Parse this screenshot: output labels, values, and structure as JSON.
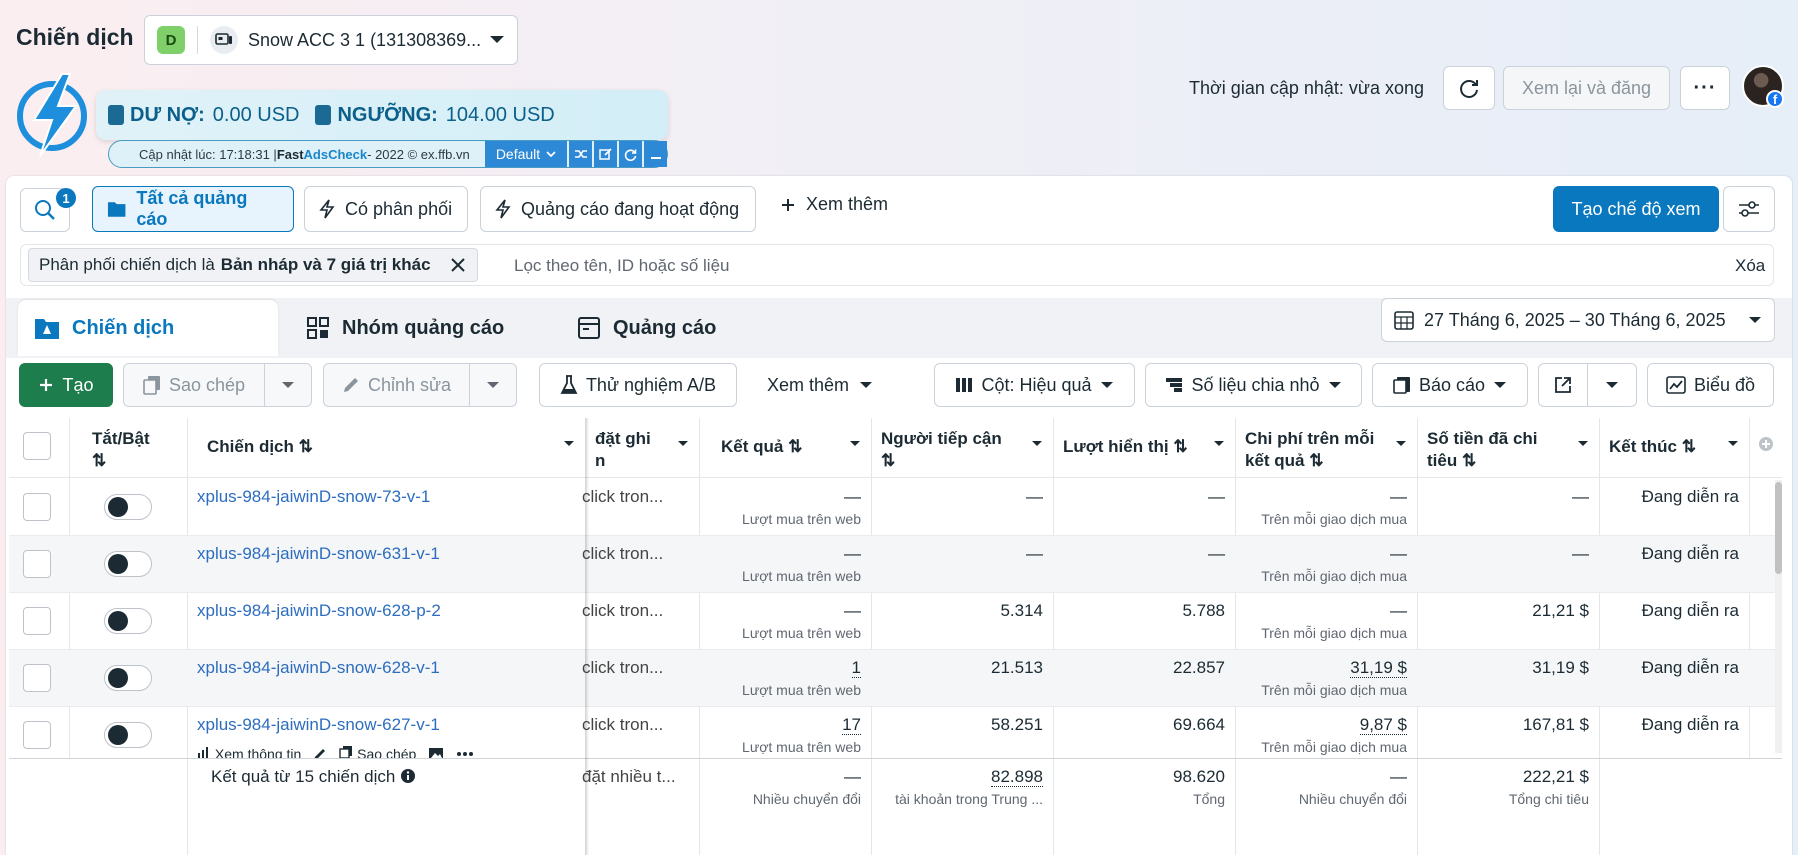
{
  "header": {
    "title": "Chiến dịch",
    "account": {
      "badge": "D",
      "name": "Snow ACC 3 1 (131308369..."
    },
    "update_time": "Thời gian cập nhật: vừa xong",
    "review_label": "Xem lại và đăng",
    "more_label": "···",
    "fb_badge": "f"
  },
  "adscheck": {
    "debt_label": "DƯ NỢ:",
    "debt_value": "0.00 USD",
    "threshold_label": "NGƯỠNG:",
    "threshold_value": "104.00 USD",
    "status_prefix": "Cập nhật lúc: 17:18:31 | ",
    "brand_fast": "Fast ",
    "brand_ads": "AdsCheck",
    "status_suffix": " - 2022 © ex.ffb.vn",
    "default_label": "Default"
  },
  "views": {
    "search_count": "1",
    "all_ads": "Tất cả quảng cáo",
    "has_delivery": "Có phân phối",
    "active_ads": "Quảng cáo đang hoạt động",
    "see_more": "Xem thêm",
    "create_view": "Tạo chế độ xem"
  },
  "filter": {
    "chip_prefix": "Phân phối chiến dịch là ",
    "chip_value": "Bản nháp và 7 giá trị khác",
    "placeholder": "Lọc theo tên, ID hoặc số liệu",
    "clear": "Xóa"
  },
  "level_tabs": {
    "campaigns": "Chiến dịch",
    "adsets": "Nhóm quảng cáo",
    "ads": "Quảng cáo"
  },
  "date_range": "27 Tháng 6, 2025 – 30 Tháng 6, 2025",
  "toolbar": {
    "create": "Tạo",
    "duplicate": "Sao chép",
    "edit": "Chỉnh sửa",
    "ab_test": "Thử nghiệm A/B",
    "see_more": "Xem thêm",
    "columns": "Cột: Hiệu quả",
    "breakdown": "Số liệu chia nhỏ",
    "reports": "Báo cáo",
    "charts": "Biểu đồ"
  },
  "table": {
    "headers": {
      "toggle": "Tắt/Bật",
      "campaign": "Chiến dịch",
      "bid": "đặt ghi",
      "bid2": "n",
      "results": "Kết quả",
      "reach": "Người tiếp cận",
      "impressions": "Lượt hiển thị",
      "cpr": "Chi phí trên mỗi",
      "cpr2": "kết quả",
      "spent": "Số tiền đã chi",
      "spent2": "tiêu",
      "ends": "Kết thúc"
    },
    "rows": [
      {
        "name": "xplus-984-jaiwinD-snow-73-v-1",
        "bid": "click tron...",
        "result": "—",
        "result_sub": "Lượt mua trên web",
        "reach": "—",
        "impr": "—",
        "cpr": "—",
        "cpr_sub": "Trên mỗi giao dịch mua",
        "spent": "—",
        "ends": "Đang diễn ra"
      },
      {
        "name": "xplus-984-jaiwinD-snow-631-v-1",
        "bid": "click tron...",
        "result": "—",
        "result_sub": "Lượt mua trên web",
        "reach": "—",
        "impr": "—",
        "cpr": "—",
        "cpr_sub": "Trên mỗi giao dịch mua",
        "spent": "—",
        "ends": "Đang diễn ra"
      },
      {
        "name": "xplus-984-jaiwinD-snow-628-p-2",
        "bid": "click tron...",
        "result": "—",
        "result_sub": "Lượt mua trên web",
        "reach": "5.314",
        "impr": "5.788",
        "cpr": "—",
        "cpr_sub": "Trên mỗi giao dịch mua",
        "spent": "21,21 $",
        "ends": "Đang diễn ra"
      },
      {
        "name": "xplus-984-jaiwinD-snow-628-v-1",
        "bid": "click tron...",
        "result": "1",
        "result_sub": "Lượt mua trên web",
        "reach": "21.513",
        "impr": "22.857",
        "cpr": "31,19 $",
        "cpr_sub": "Trên mỗi giao dịch mua",
        "spent": "31,19 $",
        "ends": "Đang diễn ra"
      },
      {
        "name": "xplus-984-jaiwinD-snow-627-v-1",
        "bid": "click tron...",
        "result": "17",
        "result_sub": "Lượt mua trên web",
        "reach": "58.251",
        "impr": "69.664",
        "cpr": "9,87 $",
        "cpr_sub": "Trên mỗi giao dịch mua",
        "spent": "167,81 $",
        "ends": "Đang diễn ra"
      }
    ],
    "row_actions": {
      "view": "Xem thông tin",
      "duplicate": "Sao chép"
    },
    "footer": {
      "label": "Kết quả từ 15 chiến dịch",
      "bid": "đặt nhiều t...",
      "result": "—",
      "result_sub": "Nhiều chuyển đổi",
      "reach": "82.898",
      "reach_sub": "tài khoản trong Trung ...",
      "impr": "98.620",
      "impr_sub": "Tổng",
      "cpr": "—",
      "cpr_sub": "Nhiều chuyển đổi",
      "spent": "222,21 $",
      "spent_sub": "Tổng chi tiêu"
    }
  },
  "colors": {
    "primary": "#0a78be",
    "create_green": "#1e7d4d",
    "link": "#2d6dbf"
  }
}
